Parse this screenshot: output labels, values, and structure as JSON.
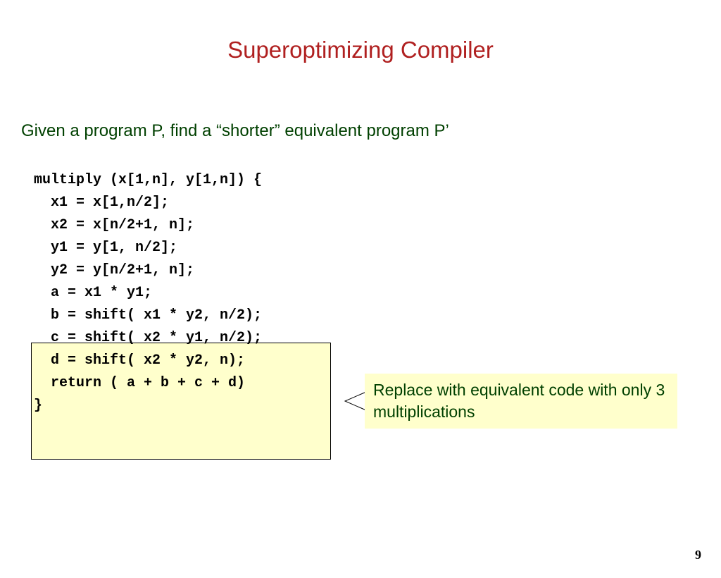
{
  "title": "Superoptimizing Compiler",
  "subtitle": "Given a program P, find a “shorter” equivalent program P’",
  "code": {
    "line0": "multiply (x[1,n], y[1,n]) {",
    "line1": "  x1 = x[1,n/2];",
    "line2": "  x2 = x[n/2+1, n];",
    "line3": "  y1 = y[1, n/2];",
    "line4": "  y2 = y[n/2+1, n];",
    "line5": "  a = x1 * y1;",
    "line6": "  b = shift( x1 * y2, n/2);",
    "line7": "  c = shift( x2 * y1, n/2);",
    "line8": "  d = shift( x2 * y2, n);",
    "line9": "  return ( a + b + c + d)",
    "line10": "}"
  },
  "callout": "Replace with equivalent code with only 3 multiplications",
  "page_number": "9"
}
